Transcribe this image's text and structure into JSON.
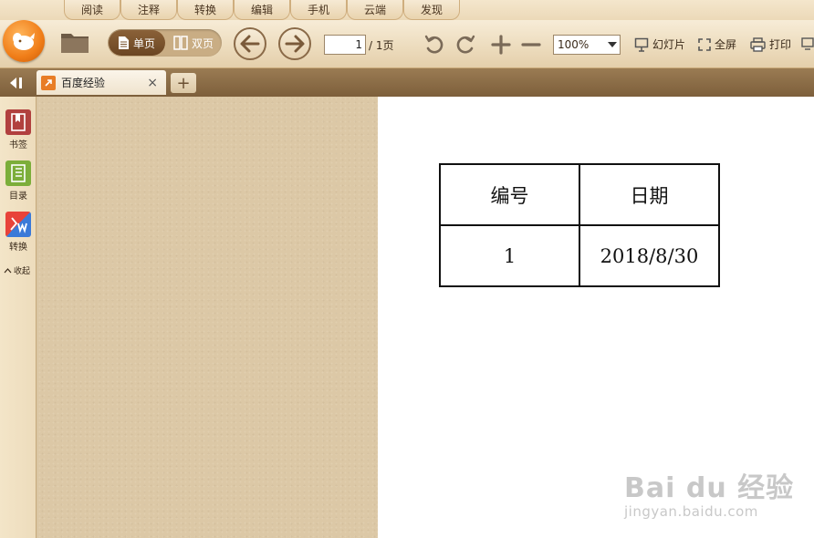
{
  "menu": {
    "tabs": [
      "阅读",
      "注释",
      "转换",
      "编辑",
      "手机",
      "云端",
      "发现"
    ]
  },
  "toolbar": {
    "single_page": "单页",
    "double_page": "双页",
    "page_current": "1",
    "page_total": "/ 1页",
    "zoom": "100%",
    "slideshow": "幻灯片",
    "fullscreen": "全屏",
    "print": "打印"
  },
  "tabs": {
    "doc_title": "百度经验",
    "close": "×",
    "new": "+"
  },
  "sidebar": {
    "items": [
      {
        "label": "书签",
        "icon": "bookmark-icon"
      },
      {
        "label": "目录",
        "icon": "toc-icon"
      },
      {
        "label": "转换",
        "icon": "pdf-to-word-icon"
      }
    ],
    "collapse": "收起"
  },
  "document": {
    "table": {
      "headers": [
        "编号",
        "日期"
      ],
      "rows": [
        [
          "1",
          "2018/8/30"
        ]
      ]
    }
  },
  "watermark": {
    "main": "Bai du 经验",
    "sub": "jingyan.baidu.com"
  },
  "colors": {
    "accent": "#f07d18",
    "toolbar_bg": "#ecdbbc",
    "tabbar_bg": "#8a6a45",
    "canvas_bg": "#dcc8a6"
  }
}
